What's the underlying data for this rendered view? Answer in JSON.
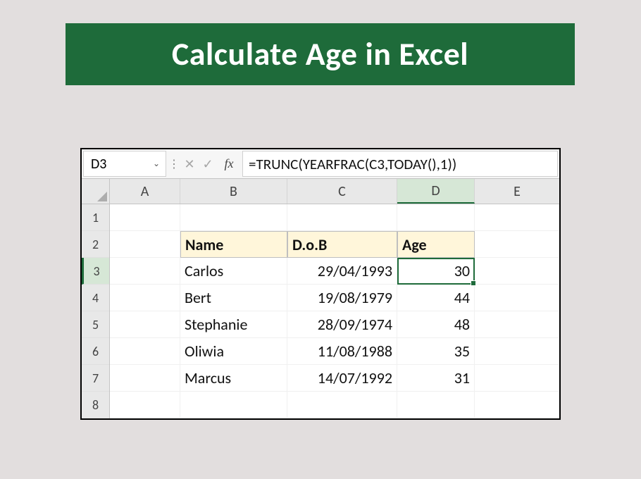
{
  "title": "Calculate Age in Excel",
  "nameBox": "D3",
  "formula": "=TRUNC(YEARFRAC(C3,TODAY(),1))",
  "fxLabel": "fx",
  "cancelGlyph": "✕",
  "acceptGlyph": "✓",
  "sepGlyph": "⋮",
  "chevron": "⌄",
  "colHeaders": [
    "A",
    "B",
    "C",
    "D",
    "E"
  ],
  "rowNums": [
    "1",
    "2",
    "3",
    "4",
    "5",
    "6",
    "7",
    "8"
  ],
  "headers": {
    "b": "Name",
    "c": "D.o.B",
    "d": "Age"
  },
  "rows": {
    "r3": {
      "b": "Carlos",
      "c": "29/04/1993",
      "d": "30"
    },
    "r4": {
      "b": "Bert",
      "c": "19/08/1979",
      "d": "44"
    },
    "r5": {
      "b": "Stephanie",
      "c": "28/09/1974",
      "d": "48"
    },
    "r6": {
      "b": "Oliwia",
      "c": "11/08/1988",
      "d": "35"
    },
    "r7": {
      "b": "Marcus",
      "c": "14/07/1992",
      "d": "31"
    }
  },
  "chart_data": {
    "type": "table",
    "title": "Calculate Age in Excel",
    "columns": [
      "Name",
      "D.o.B",
      "Age"
    ],
    "rows": [
      [
        "Carlos",
        "29/04/1993",
        30
      ],
      [
        "Bert",
        "19/08/1979",
        44
      ],
      [
        "Stephanie",
        "28/09/1974",
        48
      ],
      [
        "Oliwia",
        "11/08/1988",
        35
      ],
      [
        "Marcus",
        "14/07/1992",
        31
      ]
    ]
  }
}
